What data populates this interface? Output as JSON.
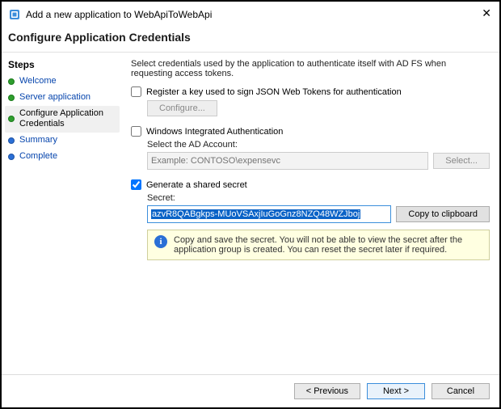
{
  "window": {
    "title": "Add a new application to WebApiToWebApi"
  },
  "header": "Configure Application Credentials",
  "sidebar": {
    "heading": "Steps",
    "items": [
      {
        "label": "Welcome"
      },
      {
        "label": "Server application"
      },
      {
        "label": "Configure Application Credentials"
      },
      {
        "label": "Summary"
      },
      {
        "label": "Complete"
      }
    ]
  },
  "content": {
    "intro": "Select credentials used by the application to authenticate itself with AD FS when requesting access tokens.",
    "registerKey": {
      "label": "Register a key used to sign JSON Web Tokens for authentication",
      "configureBtn": "Configure..."
    },
    "wia": {
      "label": "Windows Integrated Authentication",
      "sublabel": "Select the AD Account:",
      "placeholder": "Example: CONTOSO\\expensevc",
      "selectBtn": "Select..."
    },
    "sharedSecret": {
      "label": "Generate a shared secret",
      "sublabel": "Secret:",
      "value": "azvR8QABgkps-MUoVSAxjIuGoGnz8NZQ48WZJboj",
      "copyBtn": "Copy to clipboard",
      "info": "Copy and save the secret.  You will not be able to view the secret after the application group is created.  You can reset the secret later if required."
    }
  },
  "footer": {
    "previous": "< Previous",
    "next": "Next >",
    "cancel": "Cancel"
  }
}
